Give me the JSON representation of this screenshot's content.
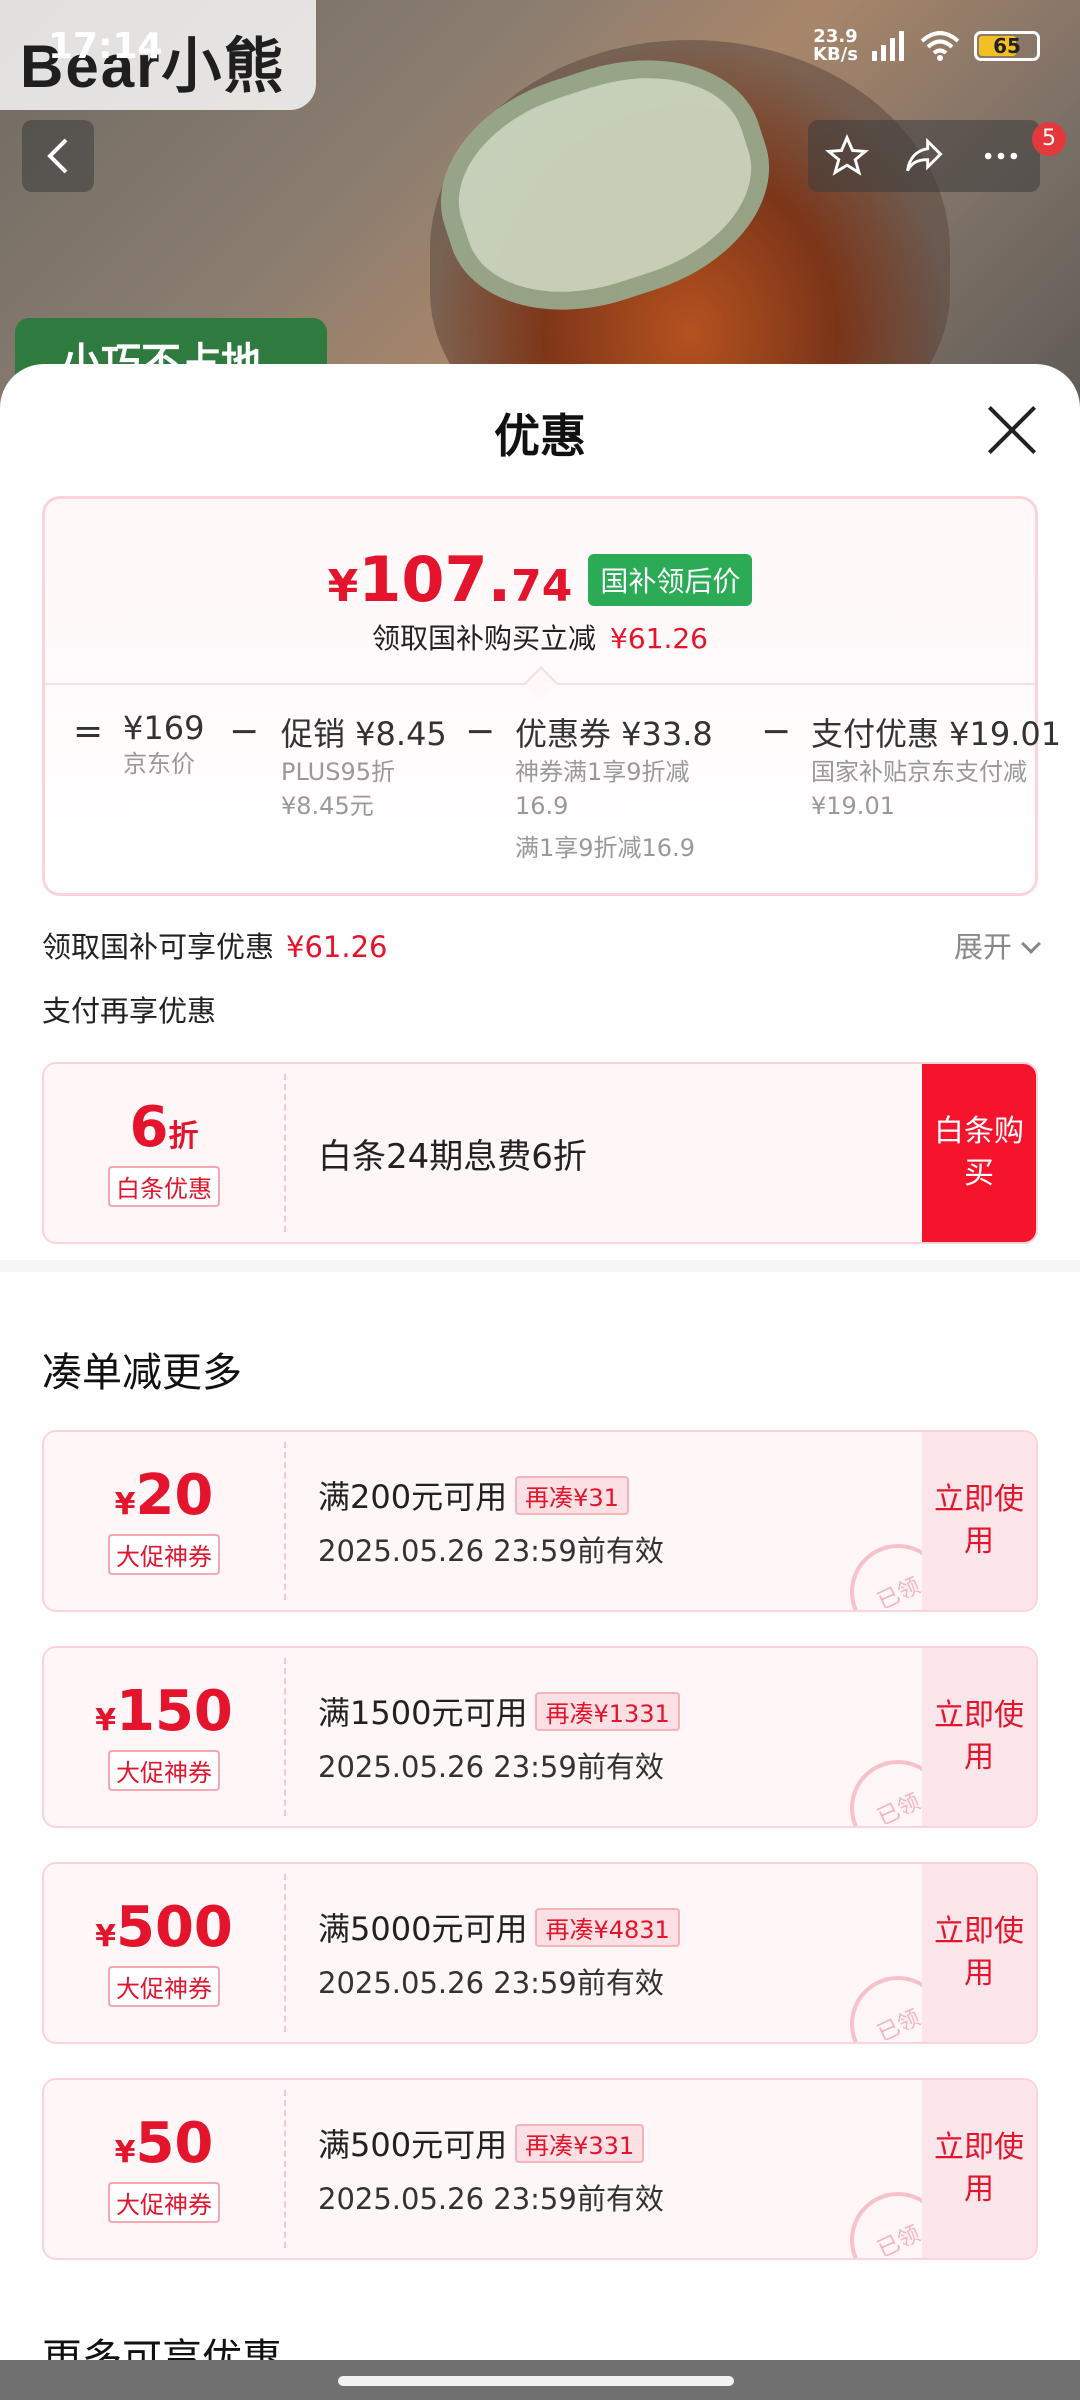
{
  "status_bar": {
    "time": "17:14",
    "net_speed_top": "23.9",
    "net_speed_bottom": "KB/s",
    "battery": "65"
  },
  "background": {
    "brand": "Bear小熊",
    "label": "小巧不占地"
  },
  "top_actions": {
    "back_icon": "chevron-left-icon",
    "badge_count": "5"
  },
  "sheet": {
    "title": "优惠",
    "price": {
      "yen": "¥",
      "integer": "107.",
      "decimal": "74",
      "tag": "国补领后价",
      "sub_label": "领取国补购买立减",
      "sub_value": "¥61.26"
    },
    "breakdown": {
      "eq": "=",
      "items": [
        {
          "head": "¥169",
          "sub1": "京东价"
        },
        {
          "head": "促销 ¥8.45",
          "sub1": "PLUS95折",
          "sub2": "¥8.45元"
        },
        {
          "head": "优惠券 ¥33.8",
          "sub1": "神券满1享9折减",
          "sub2": "16.9",
          "sub3": "满1享9折减16.9"
        },
        {
          "head": "支付优惠 ¥19.01",
          "sub1": "国家补贴京东支付减",
          "sub2": "¥19.01"
        }
      ],
      "minus": "−"
    },
    "subsidy_row": {
      "label": "领取国补可享优惠",
      "value": "¥61.26",
      "expand": "展开"
    },
    "pay_title": "支付再享优惠",
    "baitiao": {
      "value": "6",
      "unit": "折",
      "tag": "白条优惠",
      "desc": "白条24期息费6折",
      "action": "白条购买"
    },
    "bundle_title": "凑单减更多",
    "coupons": [
      {
        "sym": "¥",
        "value": "20",
        "tag": "大促神券",
        "condition": "满200元可用",
        "chip": "再凑¥31",
        "expiry": "2025.05.26 23:59前有效",
        "action": "立即使用",
        "stamp": "已领"
      },
      {
        "sym": "¥",
        "value": "150",
        "tag": "大促神券",
        "condition": "满1500元可用",
        "chip": "再凑¥1331",
        "expiry": "2025.05.26 23:59前有效",
        "action": "立即使用",
        "stamp": "已领"
      },
      {
        "sym": "¥",
        "value": "500",
        "tag": "大促神券",
        "condition": "满5000元可用",
        "chip": "再凑¥4831",
        "expiry": "2025.05.26 23:59前有效",
        "action": "立即使用",
        "stamp": "已领"
      },
      {
        "sym": "¥",
        "value": "50",
        "tag": "大促神券",
        "condition": "满500元可用",
        "chip": "再凑¥331",
        "expiry": "2025.05.26 23:59前有效",
        "action": "立即使用",
        "stamp": "已领"
      }
    ],
    "more_title": "更多可享优惠"
  },
  "colors": {
    "accent_red": "#e4142c",
    "green_tag": "#2bab55"
  }
}
